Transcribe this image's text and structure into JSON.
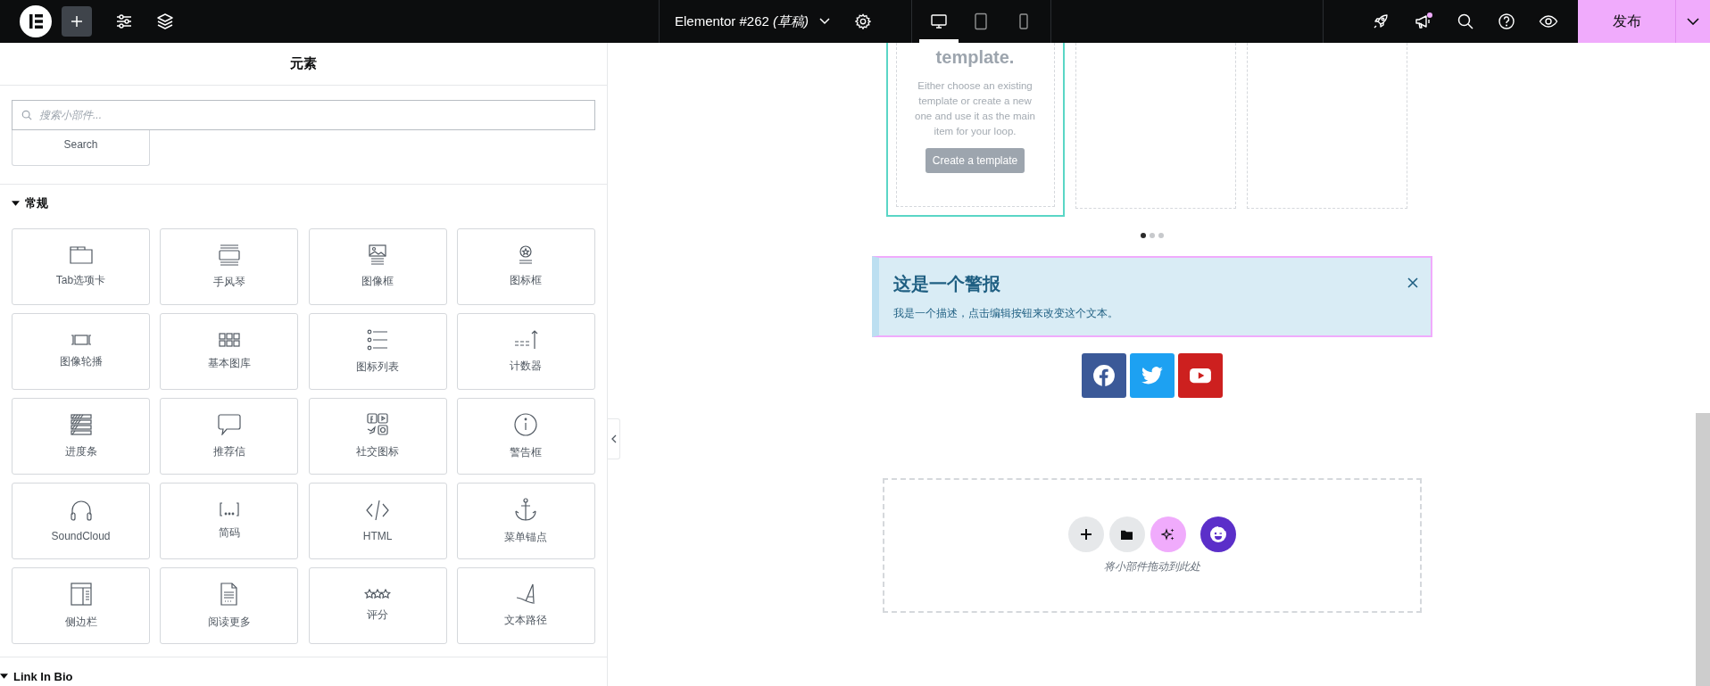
{
  "topbar": {
    "title": "Elementor #262",
    "status": "(草稿)",
    "devices": [
      {
        "kind": "desktop",
        "selected": true
      },
      {
        "kind": "tablet",
        "selected": false
      },
      {
        "kind": "mobile",
        "selected": false
      }
    ],
    "notification": true,
    "publish": "发布"
  },
  "panel": {
    "title": "元素",
    "search": {
      "placeholder": "搜索小部件..."
    },
    "partial_widget": "Search",
    "categories": [
      {
        "name": "常规",
        "expanded": true,
        "widgets": [
          {
            "label": "Tab选项卡",
            "kind": "tabs"
          },
          {
            "label": "手风琴",
            "kind": "accordion"
          },
          {
            "label": "图像框",
            "kind": "image-box"
          },
          {
            "label": "图标框",
            "kind": "icon-box"
          },
          {
            "label": "图像轮播",
            "kind": "carousel"
          },
          {
            "label": "基本图库",
            "kind": "gallery"
          },
          {
            "label": "图标列表",
            "kind": "list"
          },
          {
            "label": "计数器",
            "kind": "counter"
          },
          {
            "label": "进度条",
            "kind": "progress"
          },
          {
            "label": "推荐信",
            "kind": "testimonial"
          },
          {
            "label": "社交图标",
            "kind": "social"
          },
          {
            "label": "警告框",
            "kind": "alert"
          },
          {
            "label": "SoundCloud",
            "kind": "headphones"
          },
          {
            "label": "简码",
            "kind": "shortcode"
          },
          {
            "label": "HTML",
            "kind": "code"
          },
          {
            "label": "菜单锚点",
            "kind": "anchor"
          },
          {
            "label": "侧边栏",
            "kind": "sidebar"
          },
          {
            "label": "阅读更多",
            "kind": "document"
          },
          {
            "label": "评分",
            "kind": "stars"
          },
          {
            "label": "文本路径",
            "kind": "text-path"
          }
        ]
      },
      {
        "name": "Link In Bio",
        "expanded": true
      }
    ]
  },
  "canvas": {
    "loop_carousel": {
      "heading": "template.",
      "description": "Either choose an existing template or create a new one and use it as the main item for your loop.",
      "button": "Create a template",
      "dots": [
        {
          "selected": true
        },
        {
          "selected": false
        },
        {
          "selected": false
        }
      ]
    },
    "alert": {
      "title": "这是一个警报",
      "description": "我是一个描述，点击编辑按钮来改变这个文本。"
    },
    "social_icons": [
      {
        "kind": "facebook",
        "color": "#3b5998"
      },
      {
        "kind": "twitter",
        "color": "#1da1f2"
      },
      {
        "kind": "youtube",
        "color": "#cd201f"
      }
    ],
    "drop_zone": {
      "actions": [
        {
          "kind": "add"
        },
        {
          "kind": "template"
        },
        {
          "kind": "ai"
        },
        {
          "kind": "kit"
        }
      ],
      "hint": "将小部件拖动到此处"
    }
  }
}
